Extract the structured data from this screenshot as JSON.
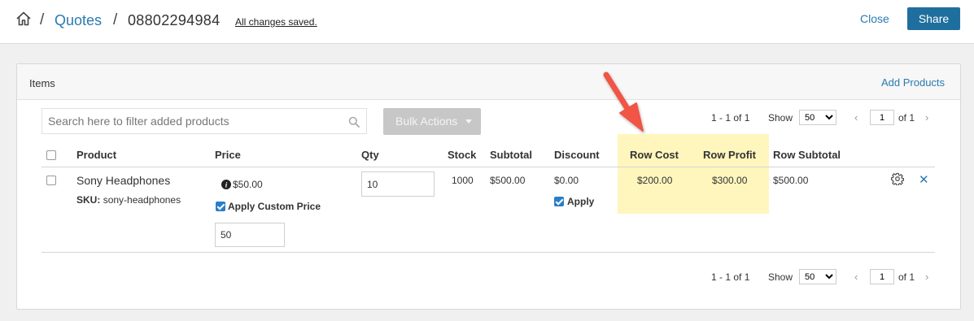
{
  "header": {
    "crumb_sep": "/",
    "breadcrumb_link": "Quotes",
    "breadcrumb_current": "08802294984",
    "saved_status": "All changes saved.",
    "close_label": "Close",
    "share_label": "Share"
  },
  "items": {
    "title": "Items",
    "add_products_label": "Add Products",
    "search_placeholder": "Search here to filter added products",
    "bulk_actions_label": "Bulk Actions",
    "pager": {
      "count_text": "1 - 1 of 1",
      "show_label": "Show",
      "page_size": "50",
      "page_value": "1",
      "of_text": "of 1"
    },
    "columns": {
      "product": "Product",
      "price": "Price",
      "qty": "Qty",
      "stock": "Stock",
      "subtotal": "Subtotal",
      "discount": "Discount",
      "row_cost": "Row Cost",
      "row_profit": "Row Profit",
      "row_subtotal": "Row Subtotal"
    },
    "row": {
      "product_name": "Sony Headphones",
      "sku_label": "SKU:",
      "sku_value": "sony-headphones",
      "price": "$50.00",
      "apply_custom_price_label": "Apply Custom Price",
      "custom_price_value": "50",
      "qty_value": "10",
      "stock": "1000",
      "subtotal": "$500.00",
      "discount": "$0.00",
      "discount_apply_label": "Apply",
      "row_cost": "$200.00",
      "row_profit": "$300.00",
      "row_subtotal": "$500.00"
    }
  },
  "colors": {
    "link": "#2a7ab0",
    "share_button": "#1f6f9e",
    "highlight": "#fff6bd",
    "annotation_arrow": "#f05545"
  }
}
